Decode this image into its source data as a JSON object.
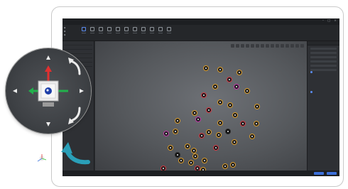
{
  "app": {
    "title": "",
    "menu": [
      "",
      "",
      "",
      ""
    ]
  },
  "viewport": {
    "markers": [
      {
        "c": "org"
      },
      {
        "c": "org"
      },
      {
        "c": "org"
      },
      {
        "c": "red"
      },
      {
        "c": "org"
      },
      {
        "c": "pink"
      },
      {
        "c": "org"
      },
      {
        "c": "red"
      },
      {
        "c": "org"
      },
      {
        "c": "org"
      },
      {
        "c": "org"
      },
      {
        "c": "red"
      },
      {
        "c": "org"
      },
      {
        "c": "org"
      },
      {
        "c": "pink"
      },
      {
        "c": "org"
      },
      {
        "c": "org"
      },
      {
        "c": "red"
      },
      {
        "c": "org"
      },
      {
        "c": "dk"
      },
      {
        "c": "org"
      },
      {
        "c": "org"
      },
      {
        "c": "red"
      },
      {
        "c": "org"
      },
      {
        "c": "org"
      },
      {
        "c": "pink"
      },
      {
        "c": "org"
      },
      {
        "c": "org"
      },
      {
        "c": "org"
      },
      {
        "c": "red"
      },
      {
        "c": "org"
      },
      {
        "c": "org"
      },
      {
        "c": "org"
      },
      {
        "c": "dk"
      },
      {
        "c": "org"
      },
      {
        "c": "org"
      },
      {
        "c": "red"
      },
      {
        "c": "org"
      },
      {
        "c": "org"
      },
      {
        "c": "grn"
      },
      {
        "c": "org"
      },
      {
        "c": "red"
      },
      {
        "c": "org"
      },
      {
        "c": "org"
      }
    ]
  },
  "gizmo": {
    "icons": {
      "up": "arrow-up-icon",
      "down": "arrow-down-icon",
      "left": "arrow-left-icon",
      "right": "arrow-right-icon",
      "rotate_cw": "rotate-cw-icon",
      "rotate_ccw": "rotate-ccw-icon",
      "view_cube": "view-cube-icon"
    },
    "axis_x_color": "#22b14c",
    "axis_z_color": "#e03030",
    "cube_face_color": "#1e3fa8"
  },
  "callout": {
    "arrow_color": "#2a9fb8",
    "icon": "curved-arrow-icon"
  },
  "colors": {
    "accent": "#3b6fd9",
    "marker_yellow": "#d9c83a",
    "marker_red": "#d33a44",
    "marker_pink": "#c13aa8"
  }
}
